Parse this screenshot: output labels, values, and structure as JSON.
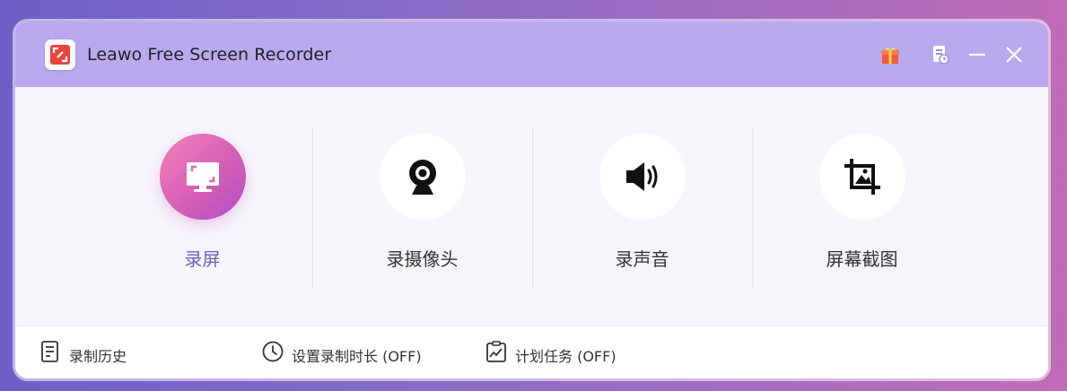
{
  "window": {
    "title": "Leawo Free Screen Recorder",
    "titlebar_color": "#b9aaf0",
    "accent_color": "#6a5fc5"
  },
  "titlebar_icons": [
    "app-logo-icon",
    "gift-icon",
    "notes-icon",
    "minimize-icon",
    "close-icon"
  ],
  "features": [
    {
      "label": "录屏",
      "icon": "screen-record-icon",
      "active": true
    },
    {
      "label": "录摄像头",
      "icon": "webcam-icon",
      "active": false
    },
    {
      "label": "录声音",
      "icon": "speaker-icon",
      "active": false
    },
    {
      "label": "屏幕截图",
      "icon": "crop-screenshot-icon",
      "active": false
    }
  ],
  "footer": {
    "history": {
      "label": "录制历史",
      "icon": "document-list-icon"
    },
    "duration": {
      "label": "设置录制时长 (OFF)",
      "icon": "clock-icon"
    },
    "schedule": {
      "label": "计划任务 (OFF)",
      "icon": "schedule-chart-icon"
    }
  }
}
